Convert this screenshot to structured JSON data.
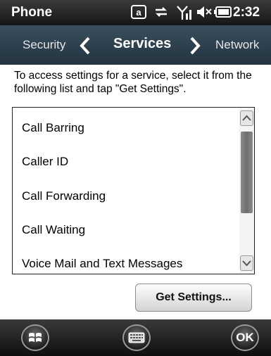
{
  "status_bar": {
    "title": "Phone",
    "time": "2:32",
    "icons": [
      "data-connection-icon",
      "sync-icon",
      "signal-icon",
      "volume-muted-icon",
      "battery-icon"
    ]
  },
  "tab_bar": {
    "previous": "Security",
    "current": "Services",
    "next": "Network"
  },
  "instructions": "To access settings for a service, select it from the following list and tap \"Get Settings\".",
  "services": [
    "Call Barring",
    "Caller ID",
    "Call Forwarding",
    "Call Waiting",
    "Voice Mail and Text Messages"
  ],
  "get_settings_label": "Get Settings...",
  "bottom_bar": {
    "start_icon": "windows-start-icon",
    "keyboard_icon": "keyboard-icon",
    "ok_label": "OK"
  },
  "colors": {
    "status_bar": "#1e1e1e",
    "tab_bar": "#2e404c",
    "bottom_bar": "#1a1a1a"
  }
}
